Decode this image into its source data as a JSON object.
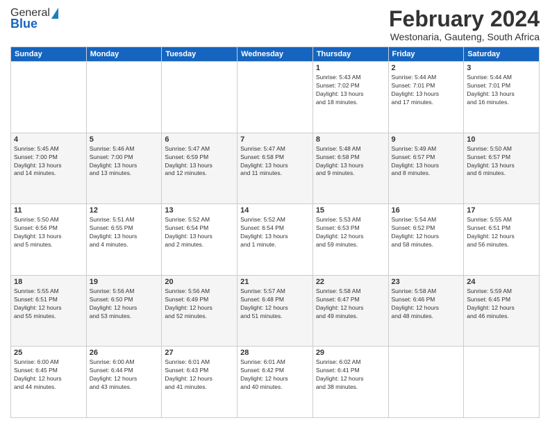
{
  "logo": {
    "general": "General",
    "blue": "Blue"
  },
  "title": "February 2024",
  "location": "Westonaria, Gauteng, South Africa",
  "days_header": [
    "Sunday",
    "Monday",
    "Tuesday",
    "Wednesday",
    "Thursday",
    "Friday",
    "Saturday"
  ],
  "weeks": [
    [
      {
        "day": "",
        "info": ""
      },
      {
        "day": "",
        "info": ""
      },
      {
        "day": "",
        "info": ""
      },
      {
        "day": "",
        "info": ""
      },
      {
        "day": "1",
        "info": "Sunrise: 5:43 AM\nSunset: 7:02 PM\nDaylight: 13 hours\nand 18 minutes."
      },
      {
        "day": "2",
        "info": "Sunrise: 5:44 AM\nSunset: 7:01 PM\nDaylight: 13 hours\nand 17 minutes."
      },
      {
        "day": "3",
        "info": "Sunrise: 5:44 AM\nSunset: 7:01 PM\nDaylight: 13 hours\nand 16 minutes."
      }
    ],
    [
      {
        "day": "4",
        "info": "Sunrise: 5:45 AM\nSunset: 7:00 PM\nDaylight: 13 hours\nand 14 minutes."
      },
      {
        "day": "5",
        "info": "Sunrise: 5:46 AM\nSunset: 7:00 PM\nDaylight: 13 hours\nand 13 minutes."
      },
      {
        "day": "6",
        "info": "Sunrise: 5:47 AM\nSunset: 6:59 PM\nDaylight: 13 hours\nand 12 minutes."
      },
      {
        "day": "7",
        "info": "Sunrise: 5:47 AM\nSunset: 6:58 PM\nDaylight: 13 hours\nand 11 minutes."
      },
      {
        "day": "8",
        "info": "Sunrise: 5:48 AM\nSunset: 6:58 PM\nDaylight: 13 hours\nand 9 minutes."
      },
      {
        "day": "9",
        "info": "Sunrise: 5:49 AM\nSunset: 6:57 PM\nDaylight: 13 hours\nand 8 minutes."
      },
      {
        "day": "10",
        "info": "Sunrise: 5:50 AM\nSunset: 6:57 PM\nDaylight: 13 hours\nand 6 minutes."
      }
    ],
    [
      {
        "day": "11",
        "info": "Sunrise: 5:50 AM\nSunset: 6:56 PM\nDaylight: 13 hours\nand 5 minutes."
      },
      {
        "day": "12",
        "info": "Sunrise: 5:51 AM\nSunset: 6:55 PM\nDaylight: 13 hours\nand 4 minutes."
      },
      {
        "day": "13",
        "info": "Sunrise: 5:52 AM\nSunset: 6:54 PM\nDaylight: 13 hours\nand 2 minutes."
      },
      {
        "day": "14",
        "info": "Sunrise: 5:52 AM\nSunset: 6:54 PM\nDaylight: 13 hours\nand 1 minute."
      },
      {
        "day": "15",
        "info": "Sunrise: 5:53 AM\nSunset: 6:53 PM\nDaylight: 12 hours\nand 59 minutes."
      },
      {
        "day": "16",
        "info": "Sunrise: 5:54 AM\nSunset: 6:52 PM\nDaylight: 12 hours\nand 58 minutes."
      },
      {
        "day": "17",
        "info": "Sunrise: 5:55 AM\nSunset: 6:51 PM\nDaylight: 12 hours\nand 56 minutes."
      }
    ],
    [
      {
        "day": "18",
        "info": "Sunrise: 5:55 AM\nSunset: 6:51 PM\nDaylight: 12 hours\nand 55 minutes."
      },
      {
        "day": "19",
        "info": "Sunrise: 5:56 AM\nSunset: 6:50 PM\nDaylight: 12 hours\nand 53 minutes."
      },
      {
        "day": "20",
        "info": "Sunrise: 5:56 AM\nSunset: 6:49 PM\nDaylight: 12 hours\nand 52 minutes."
      },
      {
        "day": "21",
        "info": "Sunrise: 5:57 AM\nSunset: 6:48 PM\nDaylight: 12 hours\nand 51 minutes."
      },
      {
        "day": "22",
        "info": "Sunrise: 5:58 AM\nSunset: 6:47 PM\nDaylight: 12 hours\nand 49 minutes."
      },
      {
        "day": "23",
        "info": "Sunrise: 5:58 AM\nSunset: 6:46 PM\nDaylight: 12 hours\nand 48 minutes."
      },
      {
        "day": "24",
        "info": "Sunrise: 5:59 AM\nSunset: 6:45 PM\nDaylight: 12 hours\nand 46 minutes."
      }
    ],
    [
      {
        "day": "25",
        "info": "Sunrise: 6:00 AM\nSunset: 6:45 PM\nDaylight: 12 hours\nand 44 minutes."
      },
      {
        "day": "26",
        "info": "Sunrise: 6:00 AM\nSunset: 6:44 PM\nDaylight: 12 hours\nand 43 minutes."
      },
      {
        "day": "27",
        "info": "Sunrise: 6:01 AM\nSunset: 6:43 PM\nDaylight: 12 hours\nand 41 minutes."
      },
      {
        "day": "28",
        "info": "Sunrise: 6:01 AM\nSunset: 6:42 PM\nDaylight: 12 hours\nand 40 minutes."
      },
      {
        "day": "29",
        "info": "Sunrise: 6:02 AM\nSunset: 6:41 PM\nDaylight: 12 hours\nand 38 minutes."
      },
      {
        "day": "",
        "info": ""
      },
      {
        "day": "",
        "info": ""
      }
    ]
  ]
}
